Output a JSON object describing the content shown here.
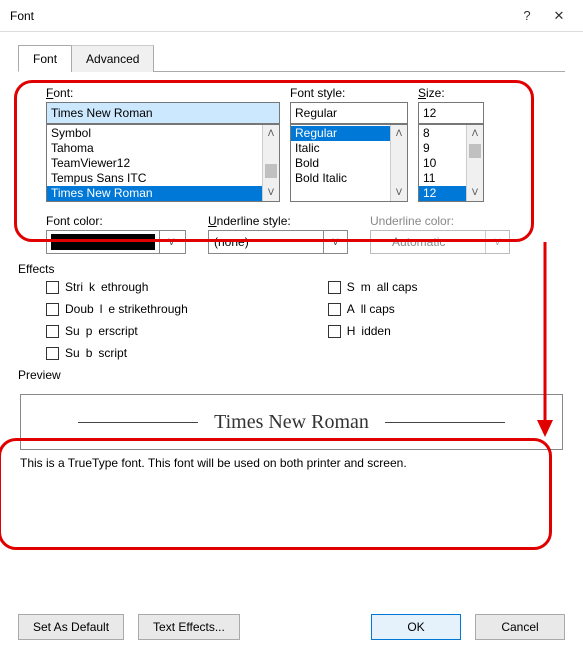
{
  "title": "Font",
  "tabs": {
    "font": "Font",
    "advanced": "Advanced"
  },
  "labels": {
    "font": "Font:",
    "style": "Font style:",
    "size": "Size:",
    "fontcolor": "Font color:",
    "underline": "Underline style:",
    "ulcolor": "Underline color:",
    "effects": "Effects",
    "preview": "Preview",
    "hint": "This is a TrueType font. This font will be used on both printer and screen."
  },
  "font": {
    "value": "Times New Roman",
    "list": [
      "Symbol",
      "Tahoma",
      "TeamViewer12",
      "Tempus Sans ITC",
      "Times New Roman"
    ],
    "selected": "Times New Roman"
  },
  "style": {
    "value": "Regular",
    "list": [
      "Regular",
      "Italic",
      "Bold",
      "Bold Italic"
    ],
    "selected": "Regular"
  },
  "size": {
    "value": "12",
    "list": [
      "8",
      "9",
      "10",
      "11",
      "12"
    ],
    "selected": "12"
  },
  "underlineStyle": "(none)",
  "underlineColor": "Automatic",
  "effectsChecks": {
    "strike": "Strikethrough",
    "dblstrike": "Double strikethrough",
    "super": "Superscript",
    "sub": "Subscript",
    "smallcaps": "Small caps",
    "allcaps": "All caps",
    "hidden": "Hidden"
  },
  "previewText": "Times New Roman",
  "buttons": {
    "setdefault": "Set As Default",
    "texteffects": "Text Effects...",
    "ok": "OK",
    "cancel": "Cancel"
  }
}
